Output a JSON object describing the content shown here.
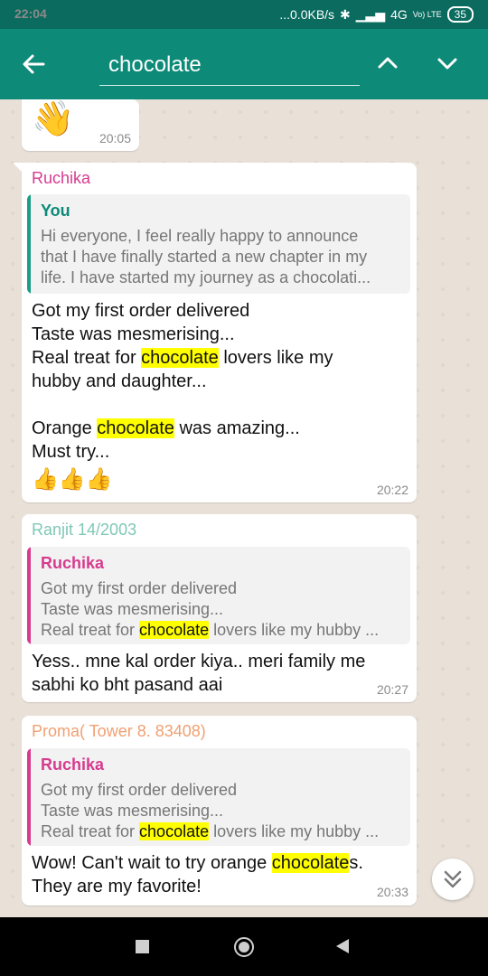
{
  "status_bar": {
    "time": "22:04",
    "network_speed": "...0.0KB/s",
    "network_type": "4G",
    "volte": "Vo) LTE",
    "battery": "35"
  },
  "search": {
    "query": "chocolate"
  },
  "messages": [
    {
      "time": "20:05",
      "emoji": "👋"
    },
    {
      "sender": "Ruchika",
      "sender_color": "#d63b8e",
      "quote": {
        "sender": "You",
        "sender_color": "#0a8a78",
        "bar_color": "#1a9e86",
        "lines": [
          "Hi everyone, I feel really happy to announce",
          "that I have finally started a new chapter in my",
          "life. I have started my journey as a chocolati..."
        ]
      },
      "lines": [
        {
          "pre": "Got my first order delivered",
          "hl": "",
          "post": ""
        },
        {
          "pre": "Taste was mesmerising...",
          "hl": "",
          "post": ""
        },
        {
          "pre": "Real treat for ",
          "hl": "chocolate",
          "post": " lovers like my"
        },
        {
          "pre": "hubby and daughter...",
          "hl": "",
          "post": ""
        },
        {
          "pre": "Orange ",
          "hl": "chocolate",
          "post": " was amazing..."
        },
        {
          "pre": "Must try...",
          "hl": "",
          "post": ""
        }
      ],
      "reaction": "👍👍👍",
      "time": "20:22"
    },
    {
      "sender": "Ranjit 14/2003",
      "sender_color": "#7fc8b7",
      "quote": {
        "sender": "Ruchika",
        "sender_color": "#d63b8e",
        "bar_color": "#d63b8e",
        "lines": [
          {
            "pre": "Got my first order delivered",
            "hl": "",
            "post": ""
          },
          {
            "pre": "Taste was mesmerising...",
            "hl": "",
            "post": ""
          },
          {
            "pre": "Real treat for ",
            "hl": "chocolate",
            "post": " lovers like my hubby ..."
          }
        ]
      },
      "lines": [
        {
          "pre": "Yess.. mne kal order kiya.. meri family me",
          "hl": "",
          "post": ""
        },
        {
          "pre": "sabhi ko bht pasand aai",
          "hl": "",
          "post": ""
        }
      ],
      "time": "20:27"
    },
    {
      "sender": "Proma( Tower 8. 83408)",
      "sender_color": "#f0a071",
      "quote": {
        "sender": "Ruchika",
        "sender_color": "#d63b8e",
        "bar_color": "#d63b8e",
        "lines": [
          {
            "pre": "Got my first order delivered",
            "hl": "",
            "post": ""
          },
          {
            "pre": "Taste was mesmerising...",
            "hl": "",
            "post": ""
          },
          {
            "pre": "Real treat for ",
            "hl": "chocolate",
            "post": " lovers like my hubby ..."
          }
        ]
      },
      "lines": [
        {
          "pre": "Wow! Can't wait to try orange ",
          "hl": "chocolate",
          "post": "s."
        },
        {
          "pre": "They are my favorite!",
          "hl": "",
          "post": ""
        }
      ],
      "time": "20:33"
    }
  ],
  "colors": {
    "toolbar": "#0e8a78",
    "status_bar": "#0b6b5f",
    "highlight": "#ffff00"
  }
}
